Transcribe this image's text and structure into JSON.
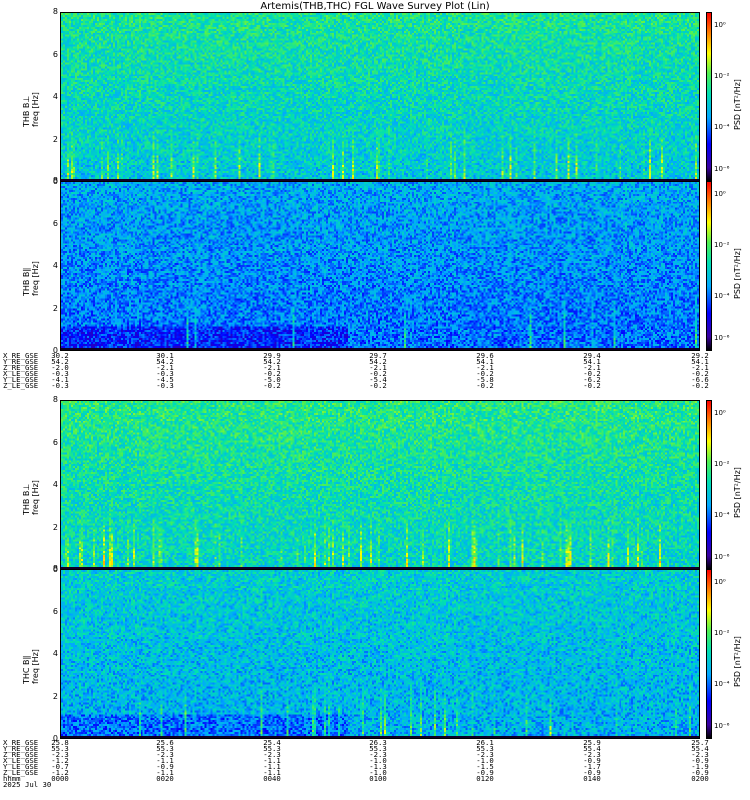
{
  "title": "Artemis(THB,THC) FGL Wave Survey Plot (Lin)",
  "colorbar": {
    "label": "PSD [nT²/Hz]",
    "ticks": [
      "10⁰",
      "10⁻²",
      "10⁻⁴",
      "10⁻⁶"
    ]
  },
  "chart_data": [
    {
      "type": "heatmap",
      "probe": "THB",
      "component": "B⊥",
      "ylabel": [
        "THB B⊥",
        "freq [Hz]"
      ],
      "ylim": [
        0,
        8
      ],
      "yticks": [
        0,
        2,
        4,
        6,
        8
      ],
      "log_color": true
    },
    {
      "type": "heatmap",
      "probe": "THB",
      "component": "B∥",
      "ylabel": [
        "THB B∥",
        "freq [Hz]"
      ],
      "ylim": [
        0,
        8
      ],
      "yticks": [
        0,
        2,
        4,
        6,
        8
      ],
      "log_color": true
    },
    {
      "type": "heatmap",
      "probe": "THB",
      "component": "B⊥",
      "ylabel": [
        "THB B⊥",
        "freq [Hz]"
      ],
      "ylim": [
        0,
        8
      ],
      "yticks": [
        0,
        2,
        4,
        6,
        8
      ],
      "log_color": true
    },
    {
      "type": "heatmap",
      "probe": "THC",
      "component": "B∥",
      "ylabel": [
        "THC B∥",
        "freq [Hz]"
      ],
      "ylim": [
        0,
        8
      ],
      "yticks": [
        0,
        2,
        4,
        6,
        8
      ],
      "log_color": true
    }
  ],
  "ephemeris_top": {
    "labels": [
      "X_RE_GSE",
      "Y_RE_GSE",
      "Z_RE_GSE",
      "X_LE_GSE",
      "Y_LE_GSE",
      "Z_LE_GSE"
    ],
    "columns": [
      [
        "30.2",
        "54.2",
        "-2.0",
        "-0.3",
        "-4.1",
        "-0.3"
      ],
      [
        "30.1",
        "54.2",
        "-2.1",
        "-0.3",
        "-4.5",
        "-0.3"
      ],
      [
        "29.9",
        "54.2",
        "-2.1",
        "-0.2",
        "-5.0",
        "-0.2"
      ],
      [
        "29.7",
        "54.2",
        "-2.1",
        "-0.2",
        "-5.4",
        "-0.2"
      ],
      [
        "29.6",
        "54.1",
        "-2.1",
        "-0.2",
        "-5.8",
        "-0.2"
      ],
      [
        "29.4",
        "54.1",
        "-2.1",
        "-0.2",
        "-6.2",
        "-0.2"
      ],
      [
        "29.2",
        "54.1",
        "-2.1",
        "-0.2",
        "-6.6",
        "-0.2"
      ]
    ]
  },
  "ephemeris_bottom": {
    "labels": [
      "X_RE_GSE",
      "Y_RE_GSE",
      "Z_RE_GSE",
      "X_LE_GSE",
      "Y_LE_GSE",
      "Z_LE_GSE",
      "hhmm",
      "2025 Jul 30"
    ],
    "columns": [
      [
        "25.8",
        "55.3",
        "-2.3",
        "-1.2",
        "-0.7",
        "-1.2",
        "0000"
      ],
      [
        "25.6",
        "55.3",
        "-2.3",
        "-1.1",
        "-0.9",
        "-1.1",
        "0020"
      ],
      [
        "25.4",
        "55.3",
        "-2.3",
        "-1.1",
        "-1.1",
        "-1.1",
        "0040"
      ],
      [
        "26.3",
        "55.3",
        "-2.3",
        "-1.0",
        "-1.3",
        "-1.0",
        "0100"
      ],
      [
        "26.1",
        "55.3",
        "-2.3",
        "-1.0",
        "-1.5",
        "-0.9",
        "0120"
      ],
      [
        "25.9",
        "55.4",
        "-2.3",
        "-0.9",
        "-1.7",
        "-0.9",
        "0140"
      ],
      [
        "25.7",
        "55.4",
        "-2.3",
        "-0.9",
        "-1.9",
        "-0.9",
        "0200"
      ]
    ]
  }
}
